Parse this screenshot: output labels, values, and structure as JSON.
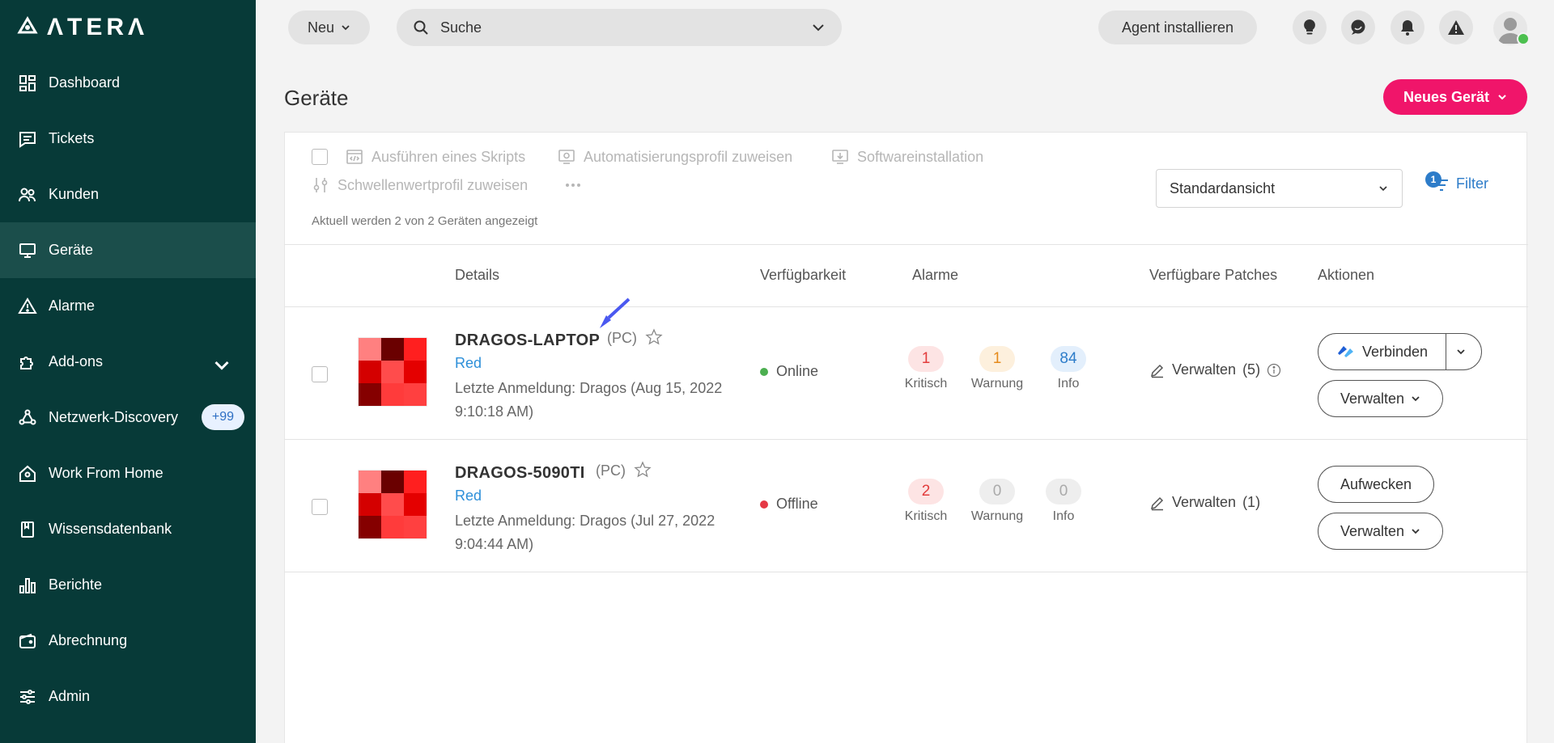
{
  "brand": {
    "logo_text": "ΛTERΛ"
  },
  "sidebar": {
    "items": [
      {
        "label": "Dashboard",
        "icon": "dashboard-icon"
      },
      {
        "label": "Tickets",
        "icon": "ticket-icon"
      },
      {
        "label": "Kunden",
        "icon": "customers-icon"
      },
      {
        "label": "Geräte",
        "icon": "devices-icon",
        "active": true
      },
      {
        "label": "Alarme",
        "icon": "alert-icon"
      },
      {
        "label": "Add-ons",
        "icon": "puzzle-icon"
      },
      {
        "label": "Netzwerk-Discovery",
        "icon": "network-icon",
        "badge": "+99"
      },
      {
        "label": "Work From Home",
        "icon": "home-icon"
      },
      {
        "label": "Wissensdatenbank",
        "icon": "book-icon"
      },
      {
        "label": "Berichte",
        "icon": "bar-chart-icon"
      },
      {
        "label": "Abrechnung",
        "icon": "wallet-icon"
      },
      {
        "label": "Admin",
        "icon": "sliders-icon"
      }
    ]
  },
  "topbar": {
    "new_label": "Neu",
    "search_label": "Suche",
    "agent_label": "Agent installieren"
  },
  "page": {
    "title": "Geräte",
    "new_device_label": "Neues Gerät"
  },
  "toolbar": {
    "run_script": "Ausführen eines Skripts",
    "assign_automation": "Automatisierungsprofil zuweisen",
    "software_install": "Softwareinstallation",
    "assign_threshold": "Schwellenwertprofil zuweisen",
    "count_text": "Aktuell werden 2 von 2 Geräten angezeigt",
    "view_label": "Standardansicht",
    "filter_label": "Filter",
    "filter_count": "1"
  },
  "table": {
    "headers": {
      "details": "Details",
      "availability": "Verfügbarkeit",
      "alarms": "Alarme",
      "patches": "Verfügbare Patches",
      "actions": "Aktionen"
    },
    "rows": [
      {
        "name": "DRAGOS-LAPTOP",
        "type": "(PC)",
        "tag": "Red",
        "login": "Letzte Anmeldung: Dragos (Aug 15, 2022 9:10:18 AM)",
        "status": "Online",
        "status_color": "#4caf50",
        "alarm_critical": "1",
        "alarm_warning": "1",
        "alarm_info": "84",
        "label_critical": "Kritisch",
        "label_warning": "Warnung",
        "label_info": "Info",
        "patch_label": "Verwalten",
        "patch_count": "(5)",
        "action_primary": "Verbinden",
        "action_secondary": "Verwalten"
      },
      {
        "name": "DRAGOS-5090TI",
        "type": "(PC)",
        "tag": "Red",
        "login": "Letzte Anmeldung: Dragos (Jul 27, 2022 9:04:44 AM)",
        "status": "Offline",
        "status_color": "#e53945",
        "alarm_critical": "2",
        "alarm_warning": "0",
        "alarm_info": "0",
        "label_critical": "Kritisch",
        "label_warning": "Warnung",
        "label_info": "Info",
        "patch_label": "Verwalten",
        "patch_count": "(1)",
        "action_primary": "Aufwecken",
        "action_secondary": "Verwalten"
      }
    ]
  },
  "colors": {
    "sidebar_bg": "#073a38",
    "accent_pink": "#f0156a",
    "link_blue": "#2d7cc9"
  }
}
